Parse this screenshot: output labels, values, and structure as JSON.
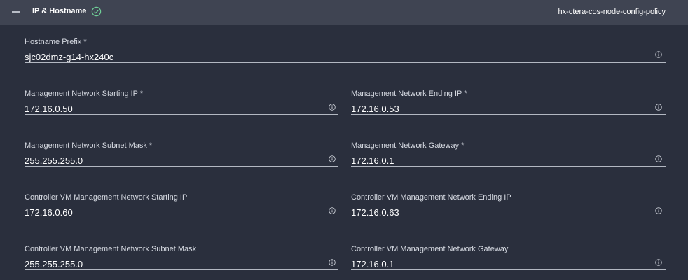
{
  "header": {
    "title": "IP & Hostname",
    "policy_name": "hx-ctera-cos-node-config-policy",
    "colors": {
      "bar": "#3f4452",
      "check": "#6fcf97"
    }
  },
  "fields": {
    "hostname_prefix": {
      "label": "Hostname Prefix *",
      "value": "sjc02dmz-g14-hx240c"
    },
    "mgmt_start_ip": {
      "label": "Management Network Starting IP *",
      "value": "172.16.0.50"
    },
    "mgmt_end_ip": {
      "label": "Management Network Ending IP *",
      "value": "172.16.0.53"
    },
    "mgmt_subnet": {
      "label": "Management Network Subnet Mask *",
      "value": "255.255.255.0"
    },
    "mgmt_gateway": {
      "label": "Management Network Gateway *",
      "value": "172.16.0.1"
    },
    "cvm_start_ip": {
      "label": "Controller VM Management Network Starting IP",
      "value": "172.16.0.60"
    },
    "cvm_end_ip": {
      "label": "Controller VM Management Network Ending IP",
      "value": "172.16.0.63"
    },
    "cvm_subnet": {
      "label": "Controller VM Management Network Subnet Mask",
      "value": "255.255.255.0"
    },
    "cvm_gateway": {
      "label": "Controller VM Management Network Gateway",
      "value": "172.16.0.1"
    }
  },
  "icons": {
    "collapse": "minus-icon",
    "status": "check-circle-icon",
    "info": "info-icon"
  }
}
